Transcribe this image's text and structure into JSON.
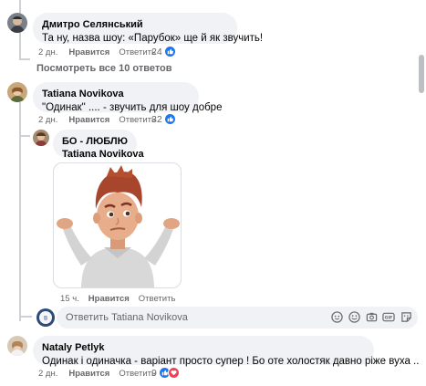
{
  "comments": [
    {
      "author": "Дмитро Селянський",
      "text": "Та ну, назва шоу: «Парубок» ще й як звучить!",
      "time": "2 дн.",
      "like_label": "Нравится",
      "reply_label": "Ответить",
      "reaction_count": "24",
      "reactions": [
        "like-icon"
      ]
    },
    {
      "author": "Tatiana Novikova",
      "text": "\"Одинак\" .... - звучить для шоу добре",
      "time": "2 дн.",
      "like_label": "Нравится",
      "reply_label": "Ответить",
      "reaction_count": "32",
      "reactions": [
        "like-icon"
      ]
    },
    {
      "author": "Nataly Petlyk",
      "text": "Одинак і одиначка - варіант просто супер ! Бо оте холостяк давно ріже вуха ..",
      "time": "2 дн.",
      "like_label": "Нравится",
      "reply_label": "Ответить",
      "reaction_count": "9",
      "reactions": [
        "like-icon",
        "love-icon"
      ]
    }
  ],
  "see_all_replies": "Посмотреть все 10 ответов",
  "nested_reply": {
    "author": "БО - ЛЮБЛЮ",
    "mention": "Tatiana Novikova",
    "sticker": "shrugging-avatar-sticker",
    "time": "15 ч.",
    "like_label": "Нравится",
    "reply_label": "Ответить"
  },
  "reply_input": {
    "placeholder": "Ответить Tatiana Novikova",
    "icons": [
      "sticker-icon",
      "emoji-icon",
      "camera-icon",
      "gif-icon",
      "sticker-smile-icon"
    ]
  },
  "colors": {
    "bubble": "#f0f2f5",
    "meta": "#65676b",
    "like": "#1877f2",
    "love": "#f33e58",
    "thread": "#ced0d4"
  }
}
